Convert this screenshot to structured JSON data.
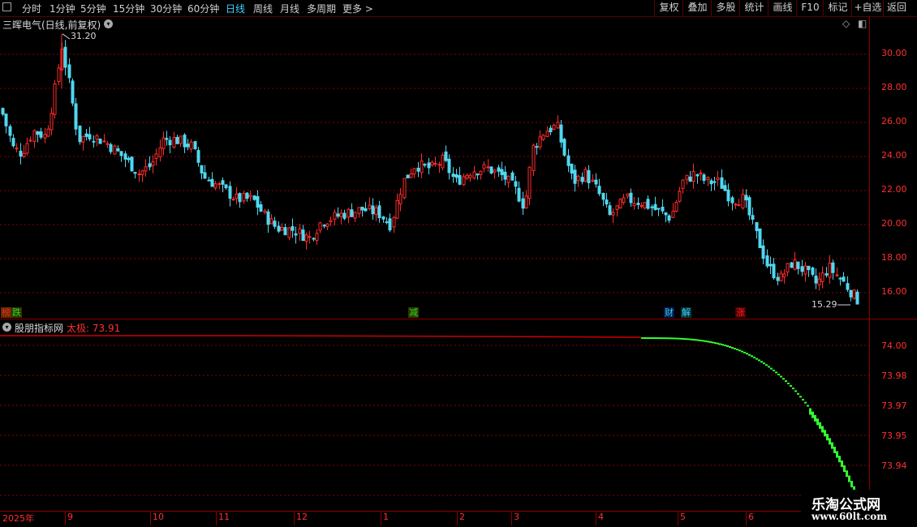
{
  "toolbar": {
    "periods": [
      "分时",
      "1分钟",
      "5分钟",
      "15分钟",
      "30分钟",
      "60分钟",
      "日线",
      "周线",
      "月线",
      "多周期",
      "更多 >"
    ],
    "active": "日线",
    "right": [
      "复权",
      "叠加",
      "多股",
      "统计",
      "画线",
      "F10",
      "标记",
      "+自选",
      "返回"
    ]
  },
  "main": {
    "title": "三晖电气(日线,前复权)",
    "high_label": "31.20",
    "low_label": "15.29",
    "yticks": [
      "30.00",
      "28.00",
      "26.00",
      "24.00",
      "22.00",
      "20.00",
      "18.00",
      "16.00"
    ],
    "events": [
      {
        "text": "榜",
        "color": "#ff2020",
        "bg": "#5a3000"
      },
      {
        "text": "跌",
        "color": "#20e020",
        "bg": "#333300"
      },
      {
        "text": "减",
        "color": "#20e020",
        "bg": "#333300"
      },
      {
        "text": "财",
        "color": "#3fd0ff",
        "bg": "#001a4a"
      },
      {
        "text": "解",
        "color": "#3fd0ff",
        "bg": "#003333"
      },
      {
        "text": "涨",
        "color": "#ff2020",
        "bg": "#4a0000"
      }
    ]
  },
  "sub": {
    "title": "股朋指标网",
    "indicator_label": "太极: 73.91",
    "yticks": [
      "74.00",
      "73.98",
      "73.97",
      "73.95",
      "73.94"
    ]
  },
  "dates": [
    "2025年",
    "9",
    "10",
    "11",
    "12",
    "1",
    "2",
    "3",
    "4",
    "5",
    "6"
  ],
  "watermark": {
    "line1": "乐淘公式网",
    "line2": "www.60lt.com"
  },
  "colors": {
    "up": "#ff2a2a",
    "down": "#4fd8f0",
    "grid": "#8a0000",
    "indicator": "#cc0000",
    "indicator_drop": "#30ff30"
  }
}
